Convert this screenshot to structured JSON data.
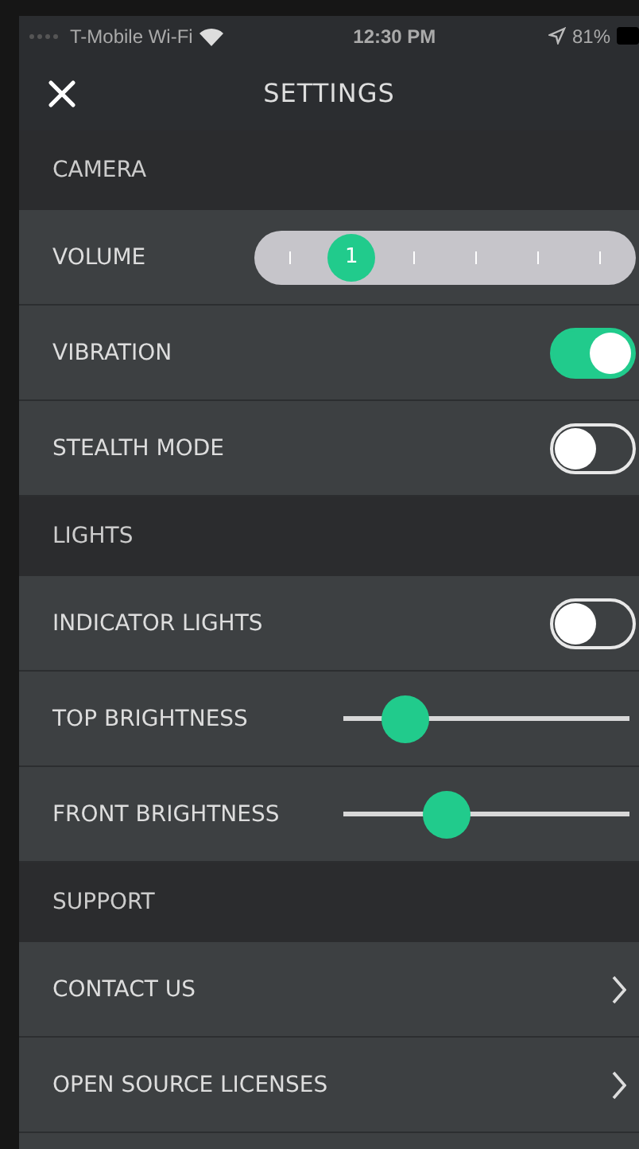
{
  "status_bar": {
    "carrier": "T-Mobile Wi-Fi",
    "time": "12:30 PM",
    "battery": "81%"
  },
  "header": {
    "title": "SETTINGS"
  },
  "sections": [
    {
      "title": "CAMERA",
      "items": [
        {
          "kind": "stepper",
          "label": "VOLUME",
          "value": "1",
          "level": 0.2
        },
        {
          "kind": "toggle",
          "label": "VIBRATION",
          "on": true
        },
        {
          "kind": "toggle",
          "label": "STEALTH MODE",
          "on": false
        }
      ]
    },
    {
      "title": "LIGHTS",
      "items": [
        {
          "kind": "toggle",
          "label": "INDICATOR LIGHTS",
          "on": false
        },
        {
          "kind": "slider",
          "label": "TOP BRIGHTNESS",
          "level": 0.16
        },
        {
          "kind": "slider",
          "label": "FRONT BRIGHTNESS",
          "level": 0.33
        }
      ]
    },
    {
      "title": "SUPPORT",
      "items": [
        {
          "kind": "link",
          "label": "CONTACT US"
        },
        {
          "kind": "link",
          "label": "OPEN SOURCE LICENSES"
        }
      ]
    }
  ]
}
